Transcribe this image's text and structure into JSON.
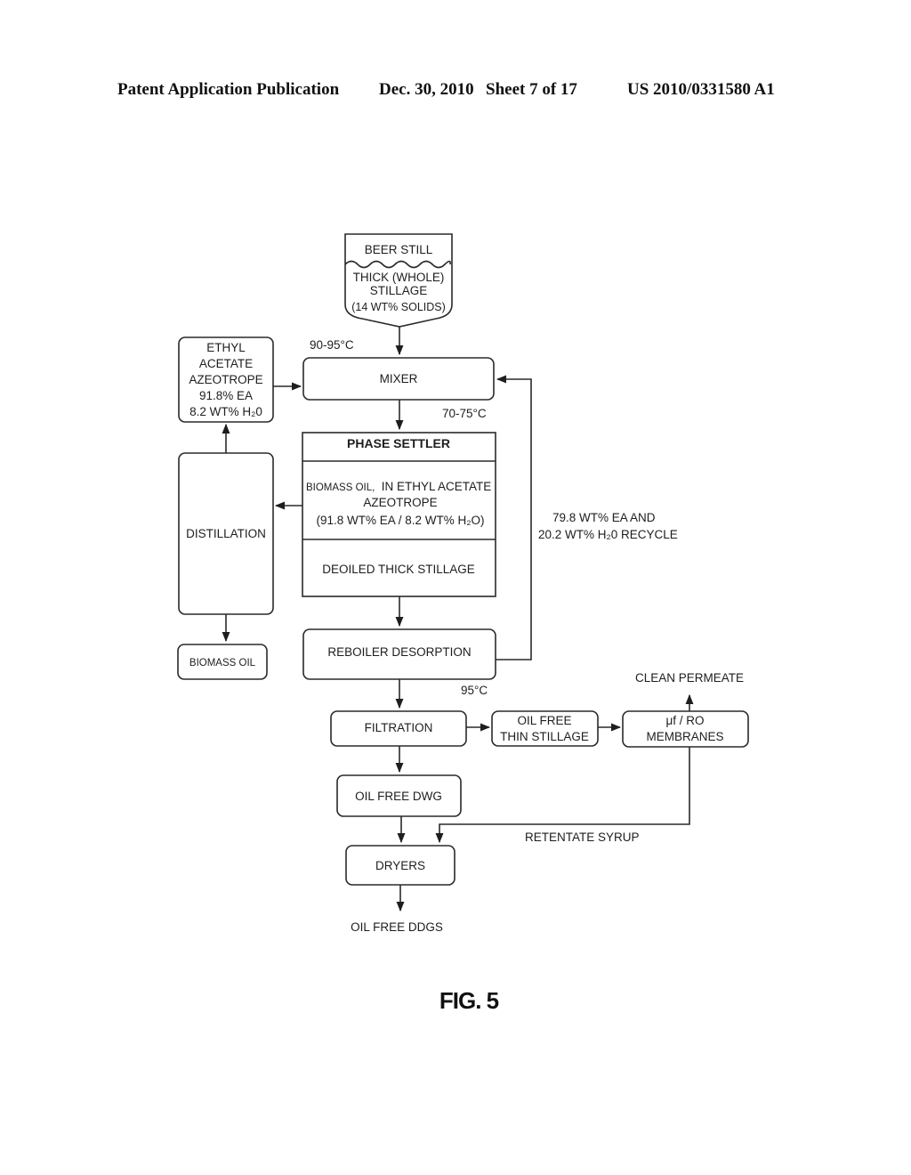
{
  "header": {
    "publication": "Patent Application Publication",
    "date": "Dec. 30, 2010",
    "sheet": "Sheet 7 of 17",
    "number": "US 2010/0331580 A1"
  },
  "diagram": {
    "beer_still": {
      "title": "BEER STILL",
      "line1": "THICK (WHOLE)",
      "line2": "STILLAGE",
      "line3": "(14 WT% SOLIDS)"
    },
    "temp_mixer_in": "90-95°C",
    "temp_mixer_out": "70-75°C",
    "temp_reboiler_out": "95°C",
    "ethyl_acetate": {
      "line1": "ETHYL",
      "line2": "ACETATE",
      "line3": "AZEOTROPE",
      "line4": "91.8% EA",
      "line5": "8.2 WT% H₂0"
    },
    "mixer": "MIXER",
    "phase_settler": {
      "title": "PHASE SETTLER",
      "oil_small": "BIOMASS OIL,",
      "oil_rest": "IN ETHYL ACETATE",
      "line2": "AZEOTROPE",
      "line3": "(91.8 WT%  EA / 8.2 WT%  H₂O)",
      "bottom": "DEOILED THICK STILLAGE"
    },
    "distillation": "DISTILLATION",
    "biomass_oil": "BIOMASS OIL",
    "recycle": {
      "line1": "79.8 WT%  EA AND",
      "line2": "20.2 WT%  H₂0 RECYCLE"
    },
    "reboiler": "REBOILER DESORPTION",
    "filtration": "FILTRATION",
    "thin_stillage": {
      "line1": "OIL FREE",
      "line2": "THIN STILLAGE"
    },
    "membranes": {
      "line1": "μf / RO",
      "line2": "MEMBRANES"
    },
    "clean_permeate": "CLEAN PERMEATE",
    "oil_free_dwg": "OIL FREE DWG",
    "retentate": "RETENTATE SYRUP",
    "dryers": "DRYERS",
    "ddgs": "OIL FREE DDGS"
  },
  "figure_label": "FIG. 5"
}
